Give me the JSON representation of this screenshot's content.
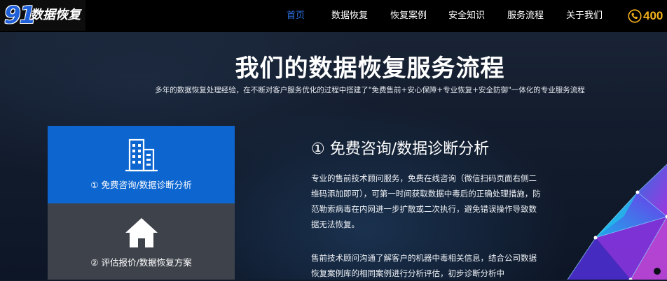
{
  "header": {
    "logo": {
      "number": "91",
      "text": "数据恢复"
    },
    "nav": [
      {
        "label": "首页",
        "active": true
      },
      {
        "label": "数据恢复",
        "active": false
      },
      {
        "label": "恢复案例",
        "active": false
      },
      {
        "label": "安全知识",
        "active": false
      },
      {
        "label": "服务流程",
        "active": false
      },
      {
        "label": "关于我们",
        "active": false
      }
    ],
    "phone": {
      "icon": "phone-icon",
      "text": "400"
    }
  },
  "hero": {
    "title": "我们的数据恢复服务流程",
    "subtitle": "多年的数据恢复处理经验，在不断对客户服务优化的过程中搭建了\"免费售前+安心保障+专业恢复+安全防御\"一体化的专业服务流程"
  },
  "steps": [
    {
      "icon": "building-icon",
      "label": "① 免费咨询/数据诊断分析",
      "active": true
    },
    {
      "icon": "home-icon",
      "label": "② 评估报价/数据恢复方案",
      "active": false
    }
  ],
  "detail": {
    "title": "① 免费咨询/数据诊断分析",
    "paragraphs": [
      "专业的售前技术顾问服务，免费在线咨询（微信扫码页面右侧二维码添加即可），可第一时间获取数据中毒后的正确处理措施，防范勒索病毒在内网进一步扩散或二次执行，避免错误操作导致数据无法恢复。",
      "售前技术顾问沟通了解客户的机器中毒相关信息，结合公司数据恢复案例库的相同案例进行分析评估，初步诊断分析中"
    ]
  },
  "colors": {
    "accent": "#0d66d0",
    "nav_active": "#2d6fe0",
    "phone": "#f2b01c",
    "card_inactive": "#3e434b"
  }
}
